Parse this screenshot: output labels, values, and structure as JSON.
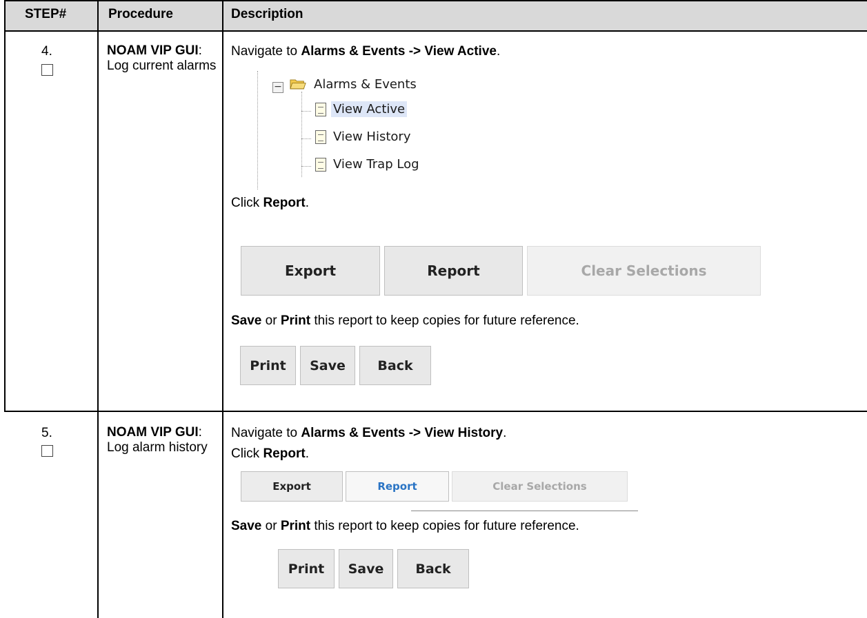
{
  "header": {
    "step": "STEP#",
    "procedure": "Procedure",
    "description": "Description"
  },
  "rows": [
    {
      "step": "4.",
      "proc_bold": "NOAM VIP GUI",
      "proc_rest": ": Log current alarms",
      "nav_prefix": "Navigate to ",
      "nav_target": "Alarms & Events -> View Active",
      "nav_suffix": ".",
      "tree": {
        "folder": "Alarms & Events",
        "items": [
          "View Active",
          "View History",
          "View Trap Log"
        ]
      },
      "click_prefix": "Click ",
      "click_target": "Report",
      "click_suffix": ".",
      "buttons": [
        "Export",
        "Report",
        "Clear Selections"
      ],
      "save_bold": "Save",
      "save_or": " or ",
      "print_bold": "Print",
      "save_rest": " this report to keep copies for future reference.",
      "print_buttons": [
        "Print",
        "Save",
        "Back"
      ]
    },
    {
      "step": "5.",
      "proc_bold": "NOAM VIP GUI",
      "proc_rest": ": Log alarm history",
      "nav_prefix": "Navigate to ",
      "nav_target": "Alarms & Events -> View History",
      "nav_suffix": ".",
      "click_prefix": "Click ",
      "click_target": "Report",
      "click_suffix": ".",
      "buttons": [
        "Export",
        "Report",
        "Clear Selections"
      ],
      "save_bold": "Save",
      "save_or": " or ",
      "print_bold": "Print",
      "save_rest": " this report to keep copies for future reference.",
      "print_buttons": [
        "Print",
        "Save",
        "Back"
      ]
    }
  ]
}
